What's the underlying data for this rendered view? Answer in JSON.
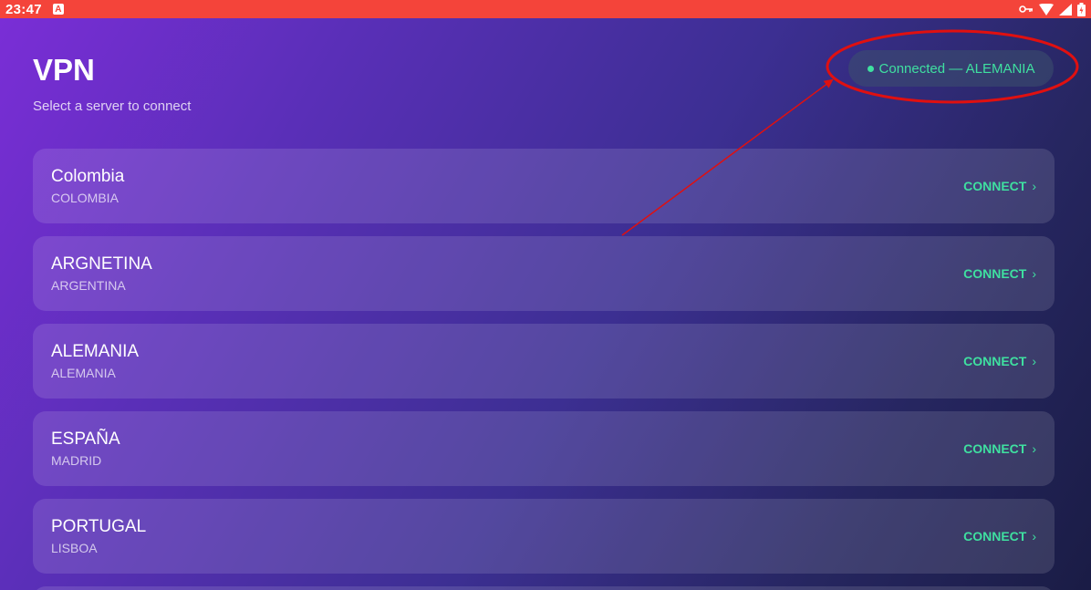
{
  "status_bar": {
    "time": "23:47",
    "badge_letter": "A",
    "icons": [
      "vpn-key-icon",
      "wifi-icon",
      "signal-icon",
      "battery-icon"
    ],
    "bg_color": "#f4443a"
  },
  "header": {
    "title": "VPN",
    "subtitle": "Select a server to connect"
  },
  "connection_status": {
    "label": "Connected — ALEMANIA",
    "color": "#3fe0a0"
  },
  "servers": [
    {
      "name": "Colombia",
      "location": "COLOMBIA",
      "action": "CONNECT"
    },
    {
      "name": "ARGNETINA",
      "location": "ARGENTINA",
      "action": "CONNECT"
    },
    {
      "name": "ALEMANIA",
      "location": "ALEMANIA",
      "action": "CONNECT"
    },
    {
      "name": "ESPAÑA",
      "location": "MADRID",
      "action": "CONNECT"
    },
    {
      "name": "PORTUGAL",
      "location": "LISBOA",
      "action": "CONNECT"
    }
  ],
  "chevron": "›",
  "annotation_color": "#e01010"
}
